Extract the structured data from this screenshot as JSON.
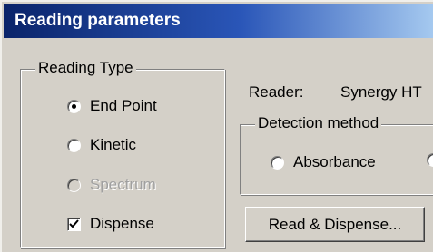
{
  "window": {
    "title": "Reading parameters"
  },
  "reading_type": {
    "legend": "Reading Type",
    "options": [
      {
        "label": "End Point",
        "checked": true,
        "disabled": false
      },
      {
        "label": "Kinetic",
        "checked": false,
        "disabled": false
      },
      {
        "label": "Spectrum",
        "checked": false,
        "disabled": true
      }
    ],
    "dispense": {
      "label": "Dispense",
      "checked": true
    }
  },
  "reader": {
    "label": "Reader:",
    "value": "Synergy HT"
  },
  "detection_method": {
    "legend": "Detection method",
    "options": [
      {
        "label": "Absorbance",
        "checked": false
      },
      {
        "label": "",
        "checked": false
      }
    ]
  },
  "buttons": {
    "read_dispense": "Read & Dispense..."
  },
  "colors": {
    "titlebar_start": "#0a246a",
    "titlebar_end": "#a6caf0",
    "face": "#d4d0c8"
  }
}
